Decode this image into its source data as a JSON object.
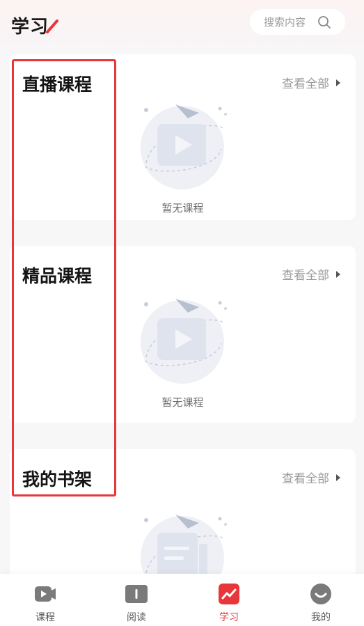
{
  "header": {
    "title": "学习",
    "search_placeholder": "搜索内容"
  },
  "sections": [
    {
      "title": "直播课程",
      "view_all": "查看全部",
      "empty_text": "暂无课程"
    },
    {
      "title": "精品课程",
      "view_all": "查看全部",
      "empty_text": "暂无课程"
    },
    {
      "title": "我的书架",
      "view_all": "查看全部",
      "empty_text": ""
    }
  ],
  "tabs": [
    {
      "label": "课程",
      "icon": "video-icon"
    },
    {
      "label": "阅读",
      "icon": "book-icon"
    },
    {
      "label": "学习",
      "icon": "study-icon",
      "active": true
    },
    {
      "label": "我的",
      "icon": "profile-icon"
    }
  ],
  "colors": {
    "accent": "#e8373a",
    "highlight_border": "#e8373a",
    "muted_text": "#9a9a9a",
    "icon_gray": "#7a7a7a"
  }
}
